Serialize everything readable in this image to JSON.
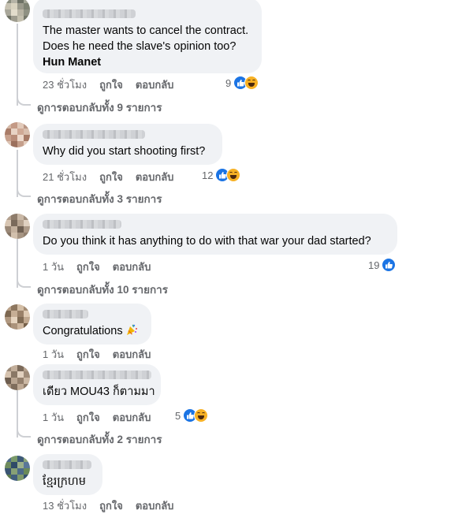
{
  "comments": [
    {
      "lines": [
        "The master wants to cancel the contract.",
        "Does he need the slave's opinion too?"
      ],
      "bold_line": "Hun Manet",
      "time": "23 ชั่วโมง",
      "like_label": "ถูกใจ",
      "reply_label": "ตอบกลับ",
      "reaction_count": "9",
      "reactions": [
        "like-icon",
        "haha-icon"
      ],
      "view_replies": "ดูการตอบกลับทั้ง 9 รายการ"
    },
    {
      "lines": [
        "Why did you start shooting first?"
      ],
      "time": "21 ชั่วโมง",
      "like_label": "ถูกใจ",
      "reply_label": "ตอบกลับ",
      "reaction_count": "12",
      "reactions": [
        "like-icon",
        "haha-icon"
      ],
      "view_replies": "ดูการตอบกลับทั้ง 3 รายการ"
    },
    {
      "lines": [
        "Do you think it has anything to do with that war your dad started?"
      ],
      "time": "1 วัน",
      "like_label": "ถูกใจ",
      "reply_label": "ตอบกลับ",
      "reaction_count": "19",
      "reactions": [
        "like-icon"
      ],
      "view_replies": "ดูการตอบกลับทั้ง 10 รายการ"
    },
    {
      "lines": [
        "Congratulations"
      ],
      "emoji": "party-popper-icon",
      "time": "1 วัน",
      "like_label": "ถูกใจ",
      "reply_label": "ตอบกลับ"
    },
    {
      "lines": [
        "เดียว MOU43 ก็ตามมา"
      ],
      "time": "1 วัน",
      "like_label": "ถูกใจ",
      "reply_label": "ตอบกลับ",
      "reaction_count": "5",
      "reactions": [
        "like-icon",
        "haha-icon"
      ],
      "view_replies": "ดูการตอบกลับทั้ง 2 รายการ"
    },
    {
      "lines": [
        "ខ្មែរក្រហម"
      ],
      "time": "13 ชั่วโมง",
      "like_label": "ถูกใจ",
      "reply_label": "ตอบกลับ"
    }
  ],
  "colors": {
    "bubble": "#f0f2f5",
    "meta_text": "#65676b",
    "like_blue": "#1b74e4",
    "haha_yellow": "#f7b125"
  }
}
